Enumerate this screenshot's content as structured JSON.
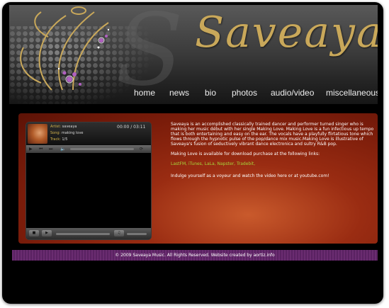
{
  "site": {
    "logo_text": "Saveaya"
  },
  "nav": {
    "items": [
      "home",
      "news",
      "bio",
      "photos",
      "audio/video",
      "miscellaneous"
    ]
  },
  "player": {
    "artist_key": "Artist:",
    "artist": "saveaya",
    "song_key": "Song:",
    "song": "making love",
    "track_key": "Track:",
    "track": "1/5",
    "time": "00:00 / 03:11"
  },
  "bio": {
    "p1": "Saveaya is an accomplished classically trained dancer and performer turned singer who is making her music début with her single Making Love. Making Love is a fun infectious up tempo that is both entertaining and easy on the ear. The vocals have a playfully flirtatious tone which flows through the hypnotic pulse of the pop/dance mix music.Making Love is illustrative of Saveaya's fusion of seductively vibrant dance electronica and sultry R&B pop.",
    "p2": "Making Love is available for download purchase at the following links:",
    "links": [
      "LastFM",
      "iTunes",
      "LaLa",
      "Napster",
      "Tradebit"
    ],
    "p3": "Indulge yourself as a voyeur and watch the video here or at youtube.com!"
  },
  "footer": {
    "text": "© 2009 Saveaya Music. All Rights Reserved.  Website created by aortiz.info"
  },
  "colors": {
    "gold": "#c9a85a",
    "link_green": "#a7d63b",
    "footer_purple": "#6a2c70"
  }
}
